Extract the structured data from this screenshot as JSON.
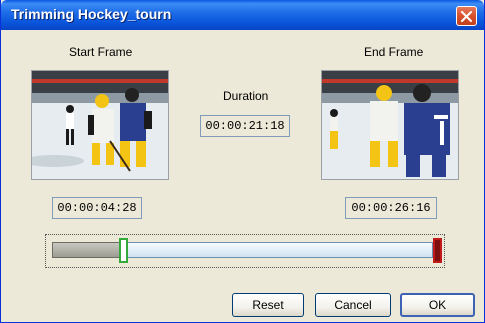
{
  "window": {
    "title": "Trimming Hockey_tourn"
  },
  "labels": {
    "start_frame": "Start Frame",
    "end_frame": "End Frame",
    "duration": "Duration"
  },
  "readouts": {
    "duration": "00:00:21:18",
    "start_time": "00:00:04:28",
    "end_time": "00:00:26:16"
  },
  "trim": {
    "start_fraction": 0.17,
    "end_fraction": 1.0
  },
  "buttons": {
    "reset": "Reset",
    "cancel": "Cancel",
    "ok": "OK"
  },
  "colors": {
    "titlebar": "#0a55db",
    "start_handle": "#35a83a",
    "end_handle": "#c21a1a"
  },
  "icons": {
    "close": "close-icon"
  }
}
